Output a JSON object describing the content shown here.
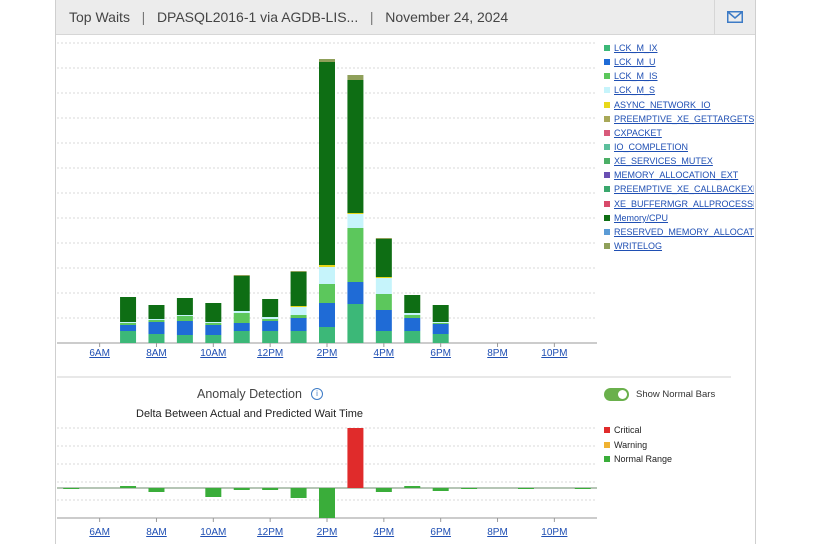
{
  "header": {
    "title": "Top Waits",
    "instance": "DPASQL2016-1 via AGDB-LIS...",
    "date": "November 24, 2024",
    "email_icon": "mail-icon"
  },
  "chart_data": [
    {
      "type": "bar",
      "stacked": true,
      "title": "",
      "xlabel": "",
      "ylabel": "",
      "x_tick_labels": [
        "6AM",
        "8AM",
        "10AM",
        "12PM",
        "2PM",
        "4PM",
        "6PM",
        "8PM",
        "10PM"
      ],
      "grid": true,
      "legend_position": "right",
      "categories": [
        "5AM",
        "6AM",
        "7AM",
        "8AM",
        "9AM",
        "10AM",
        "11AM",
        "12PM",
        "1PM",
        "2PM",
        "3PM",
        "4PM",
        "5PM",
        "6PM",
        "7PM",
        "8PM",
        "9PM",
        "10PM",
        "11PM"
      ],
      "series": [
        {
          "name": "LCK_M_IX",
          "color": "#3cb878",
          "values": [
            0,
            0,
            12,
            9,
            8,
            8,
            12,
            12,
            12,
            16,
            39,
            12,
            12,
            9,
            0,
            0,
            0,
            0,
            0
          ]
        },
        {
          "name": "LCK_M_U",
          "color": "#1f6bd6",
          "values": [
            0,
            0,
            6,
            12,
            14,
            10,
            8,
            10,
            13,
            24,
            22,
            21,
            13,
            10,
            0,
            0,
            0,
            0,
            0
          ]
        },
        {
          "name": "LCK_M_IS",
          "color": "#5cc75c",
          "values": [
            0,
            0,
            2,
            2,
            5,
            2,
            10,
            2,
            3,
            19,
            54,
            16,
            3,
            1,
            0,
            0,
            0,
            0,
            0
          ]
        },
        {
          "name": "LCK_M_S",
          "color": "#c6f4fb",
          "values": [
            0,
            0,
            1,
            1,
            1,
            1,
            2,
            2,
            8,
            17,
            14,
            16,
            2,
            1,
            0,
            0,
            0,
            0,
            0
          ]
        },
        {
          "name": "ASYNC_NETWORK_IO",
          "color": "#e8d81a",
          "values": [
            0,
            0,
            0,
            0,
            0,
            0,
            0,
            0,
            1,
            2,
            1,
            1,
            0,
            0,
            0,
            0,
            0,
            0,
            0
          ]
        },
        {
          "name": "PREEMPTIVE_XE_GETTARGETSTATE",
          "color": "#a8a858",
          "values": [
            0,
            0,
            0,
            0,
            0,
            0,
            0,
            0,
            0,
            0,
            0,
            0,
            0,
            0,
            0,
            0,
            0,
            0,
            0
          ]
        },
        {
          "name": "CXPACKET",
          "color": "#d85a7a",
          "values": [
            0,
            0,
            0,
            0,
            0,
            0,
            0,
            0,
            0,
            0,
            0,
            0,
            0,
            0,
            0,
            0,
            0,
            0,
            0
          ]
        },
        {
          "name": "IO_COMPLETION",
          "color": "#5cbf9c",
          "values": [
            0,
            0,
            0,
            0,
            0,
            0,
            0,
            0,
            0,
            0,
            0,
            0,
            0,
            0,
            0,
            0,
            0,
            0,
            0
          ]
        },
        {
          "name": "XE_SERVICES_MUTEX",
          "color": "#4caf66",
          "values": [
            0,
            0,
            0,
            0,
            0,
            0,
            0,
            0,
            0,
            0,
            0,
            0,
            0,
            0,
            0,
            0,
            0,
            0,
            0
          ]
        },
        {
          "name": "MEMORY_ALLOCATION_EXT",
          "color": "#6a4fb3",
          "values": [
            0,
            0,
            0,
            0,
            0,
            0,
            0,
            0,
            0,
            0,
            0,
            0,
            0,
            0,
            0,
            0,
            0,
            0,
            0
          ]
        },
        {
          "name": "PREEMPTIVE_XE_CALLBACKEXECUT",
          "color": "#3aa76d",
          "values": [
            0,
            0,
            0,
            0,
            0,
            0,
            0,
            0,
            0,
            0,
            0,
            0,
            0,
            0,
            0,
            0,
            0,
            0,
            0
          ]
        },
        {
          "name": "XE_BUFFERMGR_ALLPROCESSED_E",
          "color": "#d84a6a",
          "values": [
            0,
            0,
            0,
            0,
            0,
            0,
            0,
            0,
            0,
            0,
            0,
            0,
            0,
            0,
            0,
            0,
            0,
            0,
            0
          ]
        },
        {
          "name": "Memory/CPU",
          "color": "#0e6e14",
          "values": [
            0,
            0,
            25,
            14,
            17,
            19,
            35,
            18,
            34,
            203,
            133,
            38,
            18,
            17,
            0,
            0,
            0,
            0,
            0
          ]
        },
        {
          "name": "RESERVED_MEMORY_ALLOCATION",
          "color": "#5b9bd5",
          "values": [
            0,
            0,
            0,
            0,
            0,
            0,
            0,
            0,
            0,
            0,
            0,
            0,
            0,
            0,
            0,
            0,
            0,
            0,
            0
          ]
        },
        {
          "name": "WRITELOG",
          "color": "#8fa05a",
          "values": [
            0,
            0,
            0,
            0,
            0,
            0,
            1,
            0,
            1,
            3,
            5,
            1,
            0,
            0,
            0,
            0,
            0,
            0,
            0
          ]
        }
      ],
      "ylim": [
        0,
        300
      ]
    },
    {
      "type": "bar",
      "title": "Delta Between Actual and Predicted Wait Time",
      "xlabel": "",
      "ylabel": "",
      "x_tick_labels": [
        "6AM",
        "8AM",
        "10AM",
        "12PM",
        "2PM",
        "4PM",
        "6PM",
        "8PM",
        "10PM"
      ],
      "grid": true,
      "categories": [
        "5AM",
        "6AM",
        "7AM",
        "8AM",
        "9AM",
        "10AM",
        "11AM",
        "12PM",
        "1PM",
        "2PM",
        "3PM",
        "4PM",
        "5PM",
        "6PM",
        "7PM",
        "8PM",
        "9PM",
        "10PM",
        "11PM"
      ],
      "values": [
        -1,
        0,
        2,
        -4,
        0,
        -9,
        -2,
        -2,
        -10,
        -30,
        60,
        -4,
        2,
        -3,
        -1,
        0,
        -1,
        0,
        -1
      ],
      "statuses": [
        "normal",
        "normal",
        "normal",
        "normal",
        "normal",
        "normal",
        "normal",
        "normal",
        "normal",
        "normal",
        "critical",
        "normal",
        "normal",
        "normal",
        "normal",
        "normal",
        "normal",
        "normal",
        "normal"
      ],
      "ylim": [
        -30,
        60
      ],
      "legend": [
        {
          "name": "Critical",
          "color": "#e02b2b"
        },
        {
          "name": "Warning",
          "color": "#f0b232"
        },
        {
          "name": "Normal Range",
          "color": "#3aad3a"
        }
      ]
    }
  ],
  "anomaly": {
    "title": "Anomaly Detection",
    "info_icon": "info-icon",
    "toggle_label": "Show Normal Bars",
    "toggle_on": true
  }
}
